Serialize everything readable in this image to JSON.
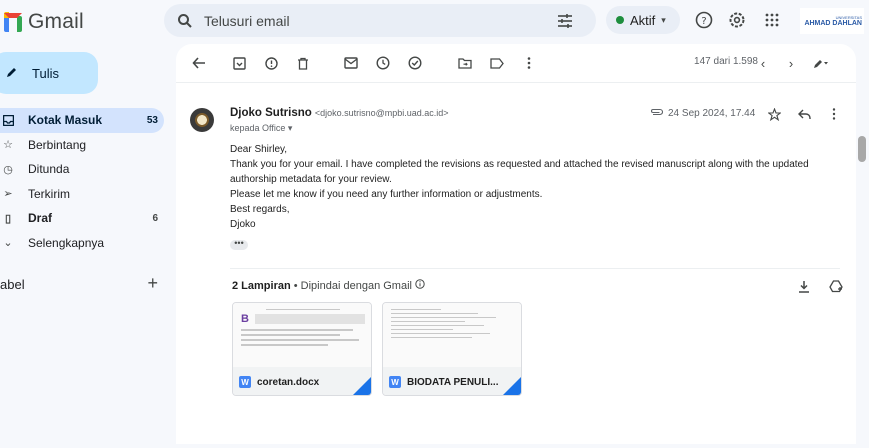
{
  "app": {
    "name": "Gmail"
  },
  "search": {
    "placeholder": "Telusuri email"
  },
  "status": {
    "label": "Aktif"
  },
  "org_logo": {
    "small": "UNIVERSITAS",
    "big": "AHMAD DAHLAN"
  },
  "sidebar": {
    "compose_label": "Tulis",
    "items": [
      {
        "label": "Kotak Masuk",
        "count": "53",
        "icon": "inbox-icon"
      },
      {
        "label": "Berbintang",
        "count": "",
        "icon": "star-icon"
      },
      {
        "label": "Ditunda",
        "count": "",
        "icon": "clock-icon"
      },
      {
        "label": "Terkirim",
        "count": "",
        "icon": "send-icon"
      },
      {
        "label": "Draf",
        "count": "6",
        "icon": "draft-icon"
      },
      {
        "label": "Selengkapnya",
        "count": "",
        "icon": "chevron-down-icon"
      }
    ],
    "labels_heading": "abel"
  },
  "toolbar": {
    "pager": "147 dari 1.598"
  },
  "email": {
    "sender_name": "Djoko Sutrisno",
    "sender_email": "<djoko.sutrisno@mpbi.uad.ac.id>",
    "recipient": "kepada Office",
    "date": "24 Sep 2024, 17.44",
    "body": [
      "Dear Shirley,",
      "Thank you for your email. I have completed the revisions as requested and attached the revised manuscript along with the updated authorship metadata for your review.",
      "Please let me know if you need any further information or adjustments.",
      "Best regards,",
      "Djoko"
    ],
    "ellipsis": "•••"
  },
  "attachments": {
    "count_label": "2 Lampiran",
    "separator": "•",
    "scan_label": "Dipindai dengan Gmail",
    "files": [
      {
        "name": "coretan.docx",
        "badge": "W"
      },
      {
        "name": "BIODATA PENULI...",
        "badge": "W"
      }
    ]
  }
}
